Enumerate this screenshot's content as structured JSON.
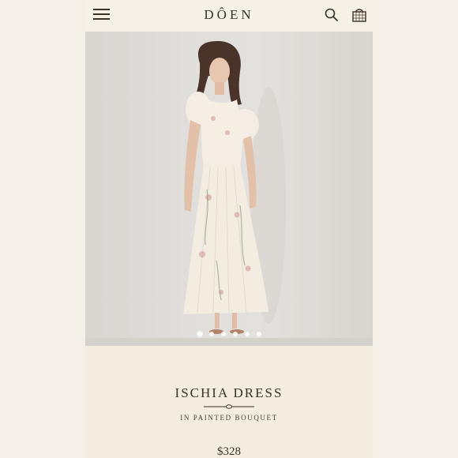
{
  "header": {
    "logo": "DÔEN"
  },
  "icons": {
    "menu": "hamburger-menu-icon",
    "search": "search-icon",
    "bag": "shopping-bag-icon"
  },
  "carousel": {
    "slide_count": 6,
    "active_index": 0
  },
  "product": {
    "name": "ISCHIA DRESS",
    "variant": "IN PAINTED BOUQUET",
    "price": "$328"
  },
  "colors": {
    "text": "#3b3026",
    "background": "#f3ede0",
    "hero_bg": "#e1dfdb"
  }
}
